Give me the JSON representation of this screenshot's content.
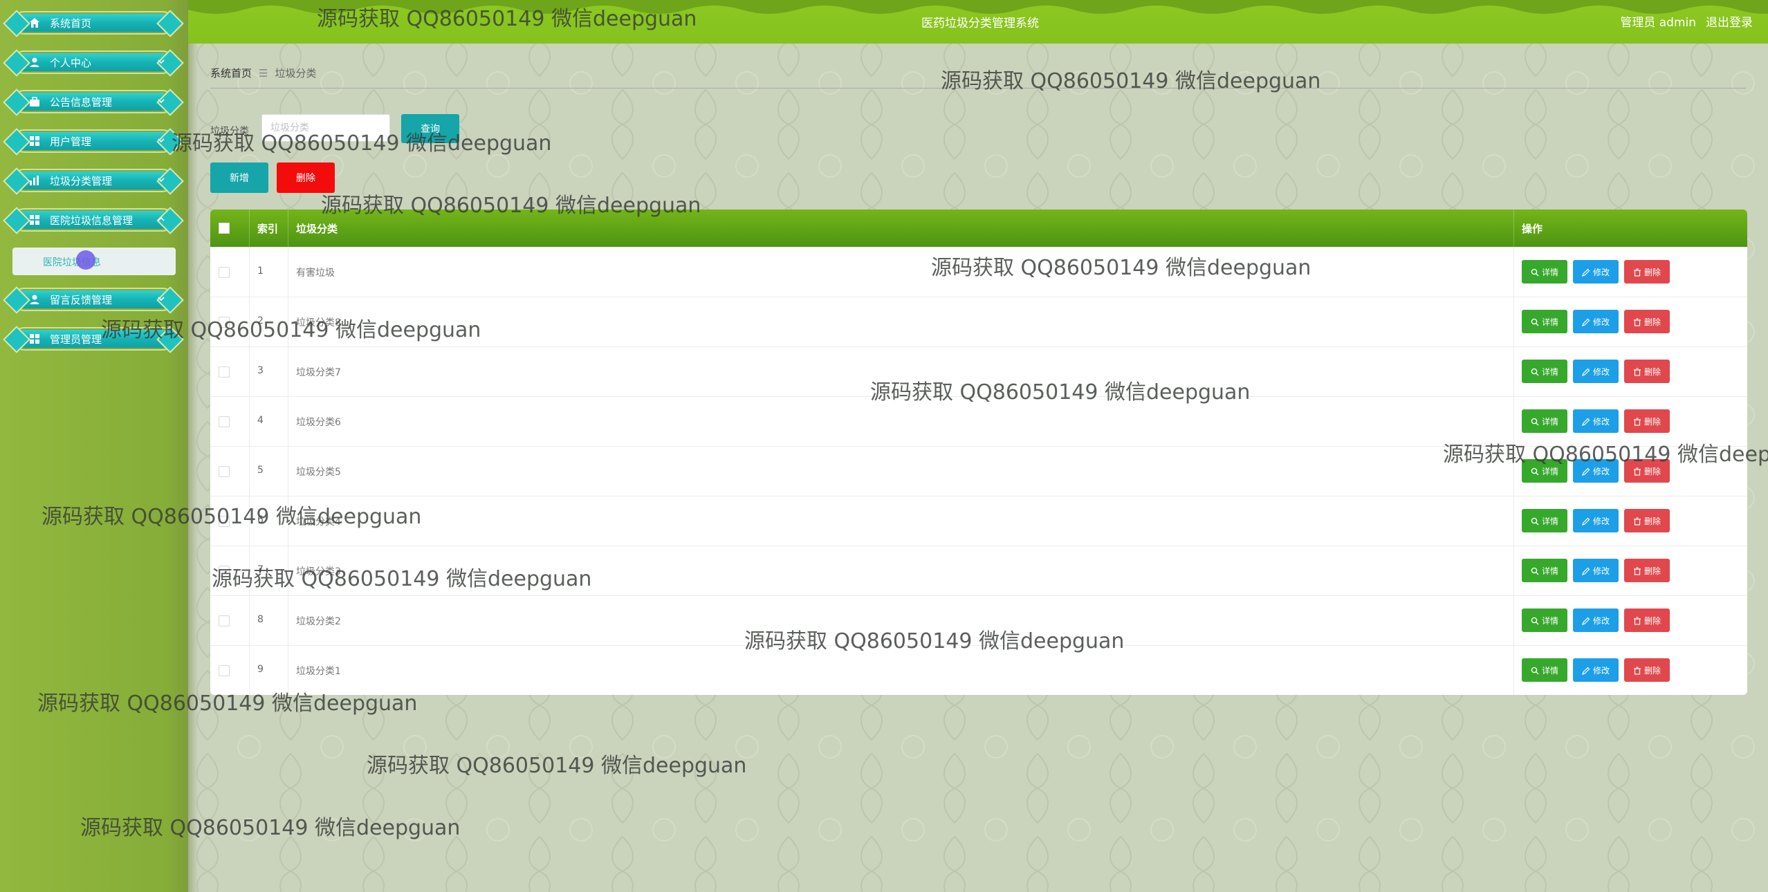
{
  "app_title": "医药垃圾分类管理系统",
  "header": {
    "user_role": "管理员 admin",
    "logout": "退出登录"
  },
  "sidebar": {
    "items": [
      {
        "label": "系统首页",
        "icon": "home-icon"
      },
      {
        "label": "个人中心",
        "icon": "user-icon"
      },
      {
        "label": "公告信息管理",
        "icon": "briefcase-icon"
      },
      {
        "label": "用户管理",
        "icon": "grid-icon"
      },
      {
        "label": "垃圾分类管理",
        "icon": "chart-icon"
      },
      {
        "label": "医院垃圾信息管理",
        "icon": "grid-icon"
      },
      {
        "label": "留言反馈管理",
        "icon": "user-icon"
      },
      {
        "label": "管理员管理",
        "icon": "grid-icon"
      }
    ],
    "sub_item": {
      "label": "医院垃圾信息"
    }
  },
  "breadcrumb": {
    "home": "系统首页",
    "separator": "☰",
    "current": "垃圾分类"
  },
  "search": {
    "label": "垃圾分类",
    "placeholder": "垃圾分类",
    "button": "查询"
  },
  "toolbar": {
    "add": "新增",
    "delete": "删除"
  },
  "table": {
    "headers": {
      "index": "索引",
      "category": "垃圾分类",
      "actions": "操作"
    },
    "rows": [
      {
        "index": "1",
        "category": "有害垃圾"
      },
      {
        "index": "2",
        "category": "垃圾分类8"
      },
      {
        "index": "3",
        "category": "垃圾分类7"
      },
      {
        "index": "4",
        "category": "垃圾分类6"
      },
      {
        "index": "5",
        "category": "垃圾分类5"
      },
      {
        "index": "6",
        "category": "垃圾分类4"
      },
      {
        "index": "7",
        "category": "垃圾分类3"
      },
      {
        "index": "8",
        "category": "垃圾分类2"
      },
      {
        "index": "9",
        "category": "垃圾分类1"
      }
    ],
    "actions": {
      "detail": "详情",
      "edit": "修改",
      "delete": "删除"
    }
  },
  "watermark_text": "源码获取 QQ86050149 微信deepguan",
  "colors": {
    "header": "#86c11e",
    "sidebar": "#8db63c",
    "menu_pill": "#17b3b4",
    "primary": "#16a5a8",
    "danger": "#f20c0c",
    "detail": "#36a82c",
    "edit": "#1d9fe8",
    "delete": "#e0484d"
  }
}
